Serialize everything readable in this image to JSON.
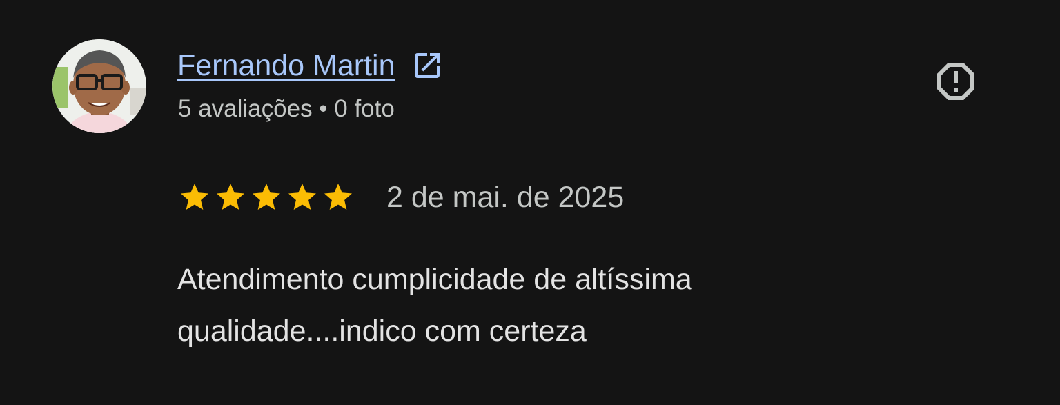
{
  "review": {
    "author_name": "Fernando Martin",
    "author_meta": "5 avaliações • 0 foto",
    "rating": 5,
    "rating_max": 5,
    "date": "2 de mai. de 2025",
    "text": "Atendimento cumplicidade de altíssima qualidade....indico com certeza"
  },
  "icons": {
    "external_link": "open-in-new-icon",
    "report": "report-icon",
    "star": "star-icon"
  },
  "colors": {
    "background": "#141414",
    "link": "#a8c7fa",
    "star": "#fbbc04",
    "secondary_text": "#c4c7c5",
    "primary_text": "#e3e3e3",
    "icon_gray": "#c4c7c5"
  }
}
